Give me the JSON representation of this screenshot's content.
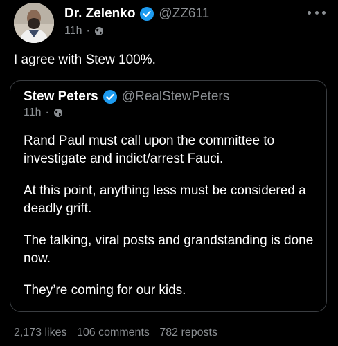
{
  "post": {
    "author": {
      "display_name": "Dr. Zelenko",
      "handle": "@ZZ611",
      "verified": true,
      "timestamp": "11h",
      "visibility_icon": "globe-icon"
    },
    "text": "I agree with Stew 100%.",
    "quoted": {
      "author": {
        "display_name": "Stew Peters",
        "handle": "@RealStewPeters",
        "verified": true,
        "timestamp": "11h",
        "visibility_icon": "globe-icon"
      },
      "paragraphs": [
        "Rand Paul must call upon the committee to investigate and indict/arrest Fauci.",
        "At this point, anything less must be considered a deadly grift.",
        "The talking, viral posts and grandstanding is done now.",
        "They’re coming for our kids."
      ]
    },
    "stats": {
      "likes": "2,173 likes",
      "comments": "106 comments",
      "reposts": "782 reposts"
    },
    "more_icon": "more-horizontal-icon",
    "colors": {
      "background": "#000000",
      "text": "#ffffff",
      "muted": "#8b8f93",
      "verified": "#1d9bf0",
      "border": "#3a3d41"
    }
  }
}
